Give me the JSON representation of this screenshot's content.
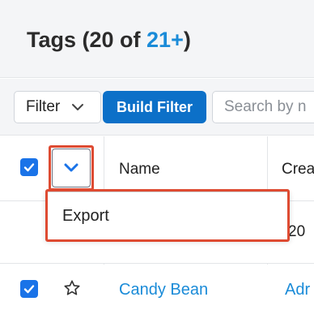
{
  "header": {
    "title_prefix": "Tags (20 of ",
    "count_link": "21+",
    "title_suffix": ")"
  },
  "filterbar": {
    "filter_label": "Filter",
    "build_filter_label": "Build Filter",
    "search_placeholder": "Search by n"
  },
  "table": {
    "columns": [
      "Name",
      "Crea"
    ],
    "rows": [
      {
        "name": "",
        "created_fragment": "20"
      },
      {
        "name": "Candy Bean",
        "created_fragment": "Adr"
      }
    ]
  },
  "dropdown": {
    "items": [
      "Export"
    ]
  },
  "colors": {
    "accent_link": "#1a8bd8",
    "build_filter_bg": "#0c70c8",
    "checkbox_blue": "#1a73e8",
    "highlight_red": "#de4b32"
  },
  "icons": {
    "filter_chevron": "chevron-down-icon",
    "action_chevron": "chevron-down-icon",
    "favorite": "star-outline-icon",
    "check": "checkmark-icon"
  }
}
